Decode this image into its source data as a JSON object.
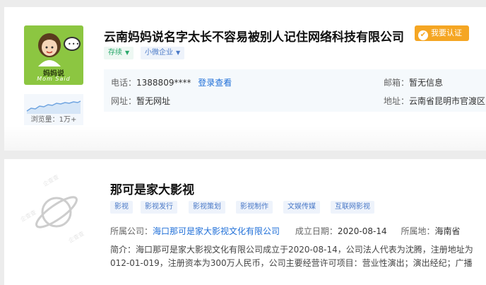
{
  "company1": {
    "logo_cn": "妈妈说",
    "logo_en": "Mom Said",
    "bubble_text": "•••",
    "name": "云南妈妈说名字太长不容易被别人记住网络科技有限公司",
    "verify_label": "我要认证",
    "verify_icon": "check-icon",
    "views": "浏览量：1万+",
    "tags": {
      "status": "存续",
      "type": "小微企业"
    },
    "phone_label": "电话：",
    "phone_value": "1388809****",
    "phone_link": "登录查看",
    "email_label": "邮箱：",
    "email_value": "暂无信息",
    "website_label": "网址：",
    "website_value": "暂无网址",
    "address_label": "地址：",
    "address_value": "云南省昆明市官渡区"
  },
  "company2": {
    "name": "那可是家大影视",
    "tags": [
      "影视",
      "影视发行",
      "影视策划",
      "影视制作",
      "文娱传媒",
      "互联网影视"
    ],
    "parent_label": "所属公司：",
    "parent_value": "海口那可是家大影视文化有限公司",
    "date_label": "成立日期：",
    "date_value": "2020-08-14",
    "region_label": "所属地：",
    "region_value": "海南省",
    "intro_line1": "简介：海口那可是家大影视文化有限公司成立于2020-08-14，公司法人代表为沈腾，注册地址为",
    "intro_line2": "012-01-019，注册资本为300万人民币，公司主要经营许可项目：营业性演出；演出经纪；广播",
    "watermark": "企查查"
  },
  "colors": {
    "accent": "#1f6fd8",
    "verify": "#f5a623",
    "logo_bg": "#8cc641",
    "status_green": "#2aa86b"
  }
}
